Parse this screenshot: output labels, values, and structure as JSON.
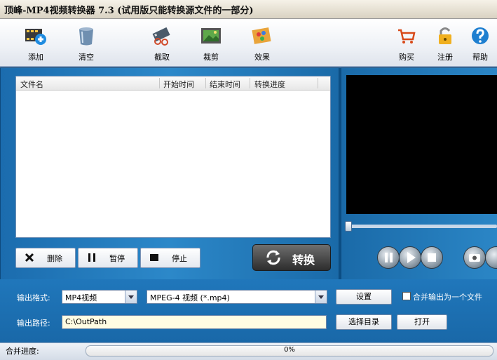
{
  "window": {
    "title": "顶峰-MP4视频转换器 7.3 (试用版只能转换源文件的一部分)"
  },
  "toolbar": {
    "add": "添加",
    "clear": "清空",
    "capture": "截取",
    "crop": "裁剪",
    "effect": "效果",
    "buy": "购买",
    "register": "注册",
    "help": "帮助"
  },
  "filelist": {
    "columns": [
      "文件名",
      "开始时间",
      "结束时间",
      "转换进度"
    ],
    "rows": []
  },
  "controls": {
    "delete": "删除",
    "pause": "暂停",
    "stop": "停止",
    "convert": "转换"
  },
  "output": {
    "format_label": "输出格式:",
    "format_value": "MP4视频",
    "codec_value": "MPEG-4 视频 (*.mp4)",
    "settings": "设置",
    "merge_label": "合并输出为一个文件",
    "path_label": "输出路径:",
    "path_value": "C:\\OutPath",
    "browse": "选择目录",
    "open": "打开"
  },
  "status": {
    "merge_progress_label": "合并进度:",
    "progress_text": "0%",
    "progress": 0
  },
  "colors": {
    "panel": "#1b6cae",
    "video": "#000000",
    "accent": "#2c88c9"
  },
  "icons": [
    "add-film-icon",
    "clear-bin-icon",
    "capture-icon",
    "crop-film-icon",
    "effect-palette-icon",
    "cart-icon",
    "lock-icon",
    "help-icon",
    "delete-icon",
    "pause-icon",
    "stop-icon",
    "refresh-icon"
  ]
}
